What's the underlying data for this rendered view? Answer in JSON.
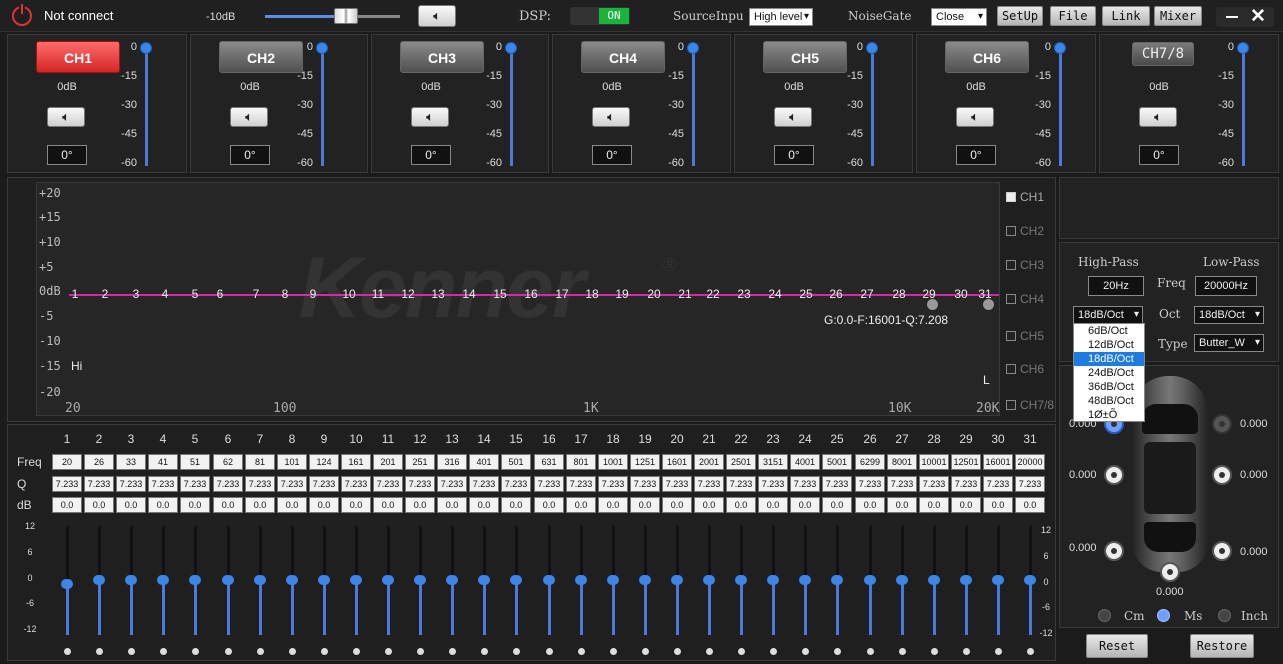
{
  "header": {
    "status": "Not connect",
    "volume": "-10dB",
    "dsp_label": "DSP:",
    "dsp_state": "ON",
    "source_label": "SourceInpu",
    "source_value": "High level",
    "noise_label": "NoiseGate",
    "noise_value": "Close",
    "buttons": [
      "SetUp",
      "File",
      "Link",
      "Mixer"
    ],
    "volume_level": 0.6
  },
  "channels": [
    {
      "name": "CH1",
      "gain": "0dB",
      "phase": "0°"
    },
    {
      "name": "CH2",
      "gain": "0dB",
      "phase": "0°"
    },
    {
      "name": "CH3",
      "gain": "0dB",
      "phase": "0°"
    },
    {
      "name": "CH4",
      "gain": "0dB",
      "phase": "0°"
    },
    {
      "name": "CH5",
      "gain": "0dB",
      "phase": "0°"
    },
    {
      "name": "CH6",
      "gain": "0dB",
      "phase": "0°"
    },
    {
      "name": "CH7/8",
      "gain": "0dB",
      "phase": "0°"
    }
  ],
  "level_scale": [
    "0",
    "-15",
    "-30",
    "-45",
    "-60"
  ],
  "graph": {
    "ylabels": [
      "+20",
      "+15",
      "+10",
      "+5",
      "0dB",
      "-5",
      "-10",
      "-15",
      "-20"
    ],
    "xlabels": [
      "20",
      "100",
      "1K",
      "10K",
      "20K"
    ],
    "info": "G:0.0-F:16001-Q:7.208",
    "hi": "Hi",
    "lo": "L",
    "watermark": "Kenner"
  },
  "channel_checks": [
    "CH1",
    "CH2",
    "CH3",
    "CH4",
    "CH5",
    "CH6",
    "CH7/8"
  ],
  "eq": {
    "bands": [
      "1",
      "2",
      "3",
      "4",
      "5",
      "6",
      "7",
      "8",
      "9",
      "10",
      "11",
      "12",
      "13",
      "14",
      "15",
      "16",
      "17",
      "18",
      "19",
      "20",
      "21",
      "22",
      "23",
      "24",
      "25",
      "26",
      "27",
      "28",
      "29",
      "30",
      "31"
    ],
    "freq": [
      "20",
      "26",
      "33",
      "41",
      "51",
      "62",
      "81",
      "101",
      "124",
      "161",
      "201",
      "251",
      "316",
      "401",
      "501",
      "631",
      "801",
      "1001",
      "1251",
      "1601",
      "2001",
      "2501",
      "3151",
      "4001",
      "5001",
      "6299",
      "8001",
      "10001",
      "12501",
      "16001",
      "20000"
    ],
    "q": "7.233",
    "db": "0.0",
    "row_labels": [
      "Freq",
      "Q",
      "dB"
    ],
    "scale": [
      "12",
      "6",
      "0",
      "-6",
      "-12"
    ]
  },
  "crossover": {
    "hp_label": "High-Pass",
    "lp_label": "Low-Pass",
    "freq_label": "Freq",
    "oct_label": "Oct",
    "type_label": "Type",
    "hp_freq": "20Hz",
    "lp_freq": "20000Hz",
    "hp_oct": "18dB/Oct",
    "lp_oct": "18dB/Oct",
    "type": "Butter_W",
    "oct_options": [
      "6dB/Oct",
      "12dB/Oct",
      "18dB/Oct",
      "24dB/Oct",
      "36dB/Oct",
      "48dB/Oct",
      "1Ø±Õ"
    ]
  },
  "delay": {
    "values": [
      "0.000",
      "0.000",
      "0.000",
      "0.000",
      "0.000",
      "0.000",
      "0.000"
    ],
    "units": [
      "Cm",
      "Ms",
      "Inch"
    ],
    "selected_unit": "Ms"
  },
  "actions": {
    "reset": "Reset",
    "restore": "Restore"
  }
}
